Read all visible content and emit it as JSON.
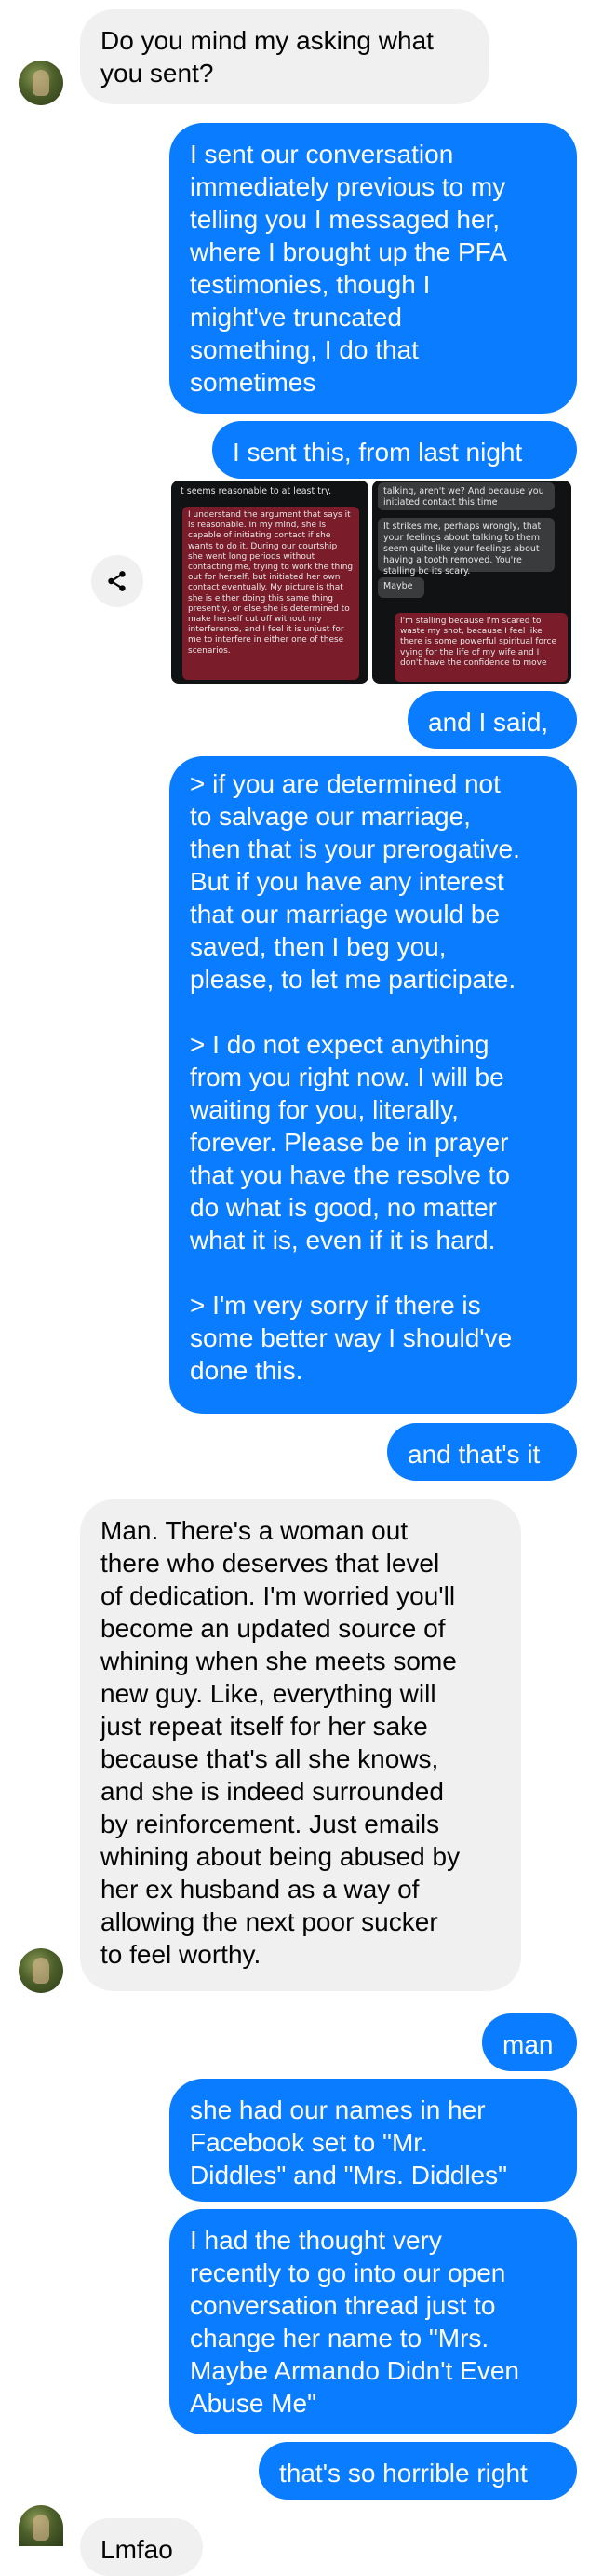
{
  "messages": [
    {
      "id": "m1",
      "dir": "in",
      "text": "Do you mind my asking what\nyou sent?"
    },
    {
      "id": "m2",
      "dir": "out",
      "text": "I sent our conversation\nimmediately previous to my\ntelling you I messaged her,\nwhere I brought up the PFA\ntestimonies, though I\nmight've truncated\nsomething, I do that\nsometimes"
    },
    {
      "id": "m3",
      "dir": "out",
      "text": "I sent this, from last night"
    },
    {
      "id": "m4",
      "dir": "out",
      "text": "and I said,"
    },
    {
      "id": "m5",
      "dir": "out",
      "text": "> if you are determined not\nto salvage our marriage,\nthen that is your prerogative.\nBut if you have any interest\nthat our marriage would be\nsaved, then I beg you,\nplease, to let me participate.\n\n> I do not expect anything\nfrom you right now. I will be\nwaiting for you, literally,\nforever. Please be in prayer\nthat you have the resolve to\ndo what is good, no matter\nwhat it is, even if it is hard.\n\n> I'm very sorry if there is\nsome better way I should've\ndone this."
    },
    {
      "id": "m6",
      "dir": "out",
      "text": "and that's it"
    },
    {
      "id": "m7",
      "dir": "in",
      "text": "Man. There's a woman out\nthere who deserves that level\nof dedication. I'm worried you'll\nbecome an updated source of\nwhining when she meets some\nnew guy. Like, everything will\njust repeat itself for her sake\nbecause that's all she knows,\nand she is indeed surrounded\nby reinforcement. Just emails\nwhining about being abused by\nher ex husband as a way of\nallowing the next poor sucker\nto feel worthy."
    },
    {
      "id": "m8",
      "dir": "out",
      "text": "man"
    },
    {
      "id": "m9",
      "dir": "out",
      "text": "she had our names in her\nFacebook set to \"Mr.\nDiddles\" and \"Mrs. Diddles\""
    },
    {
      "id": "m10",
      "dir": "out",
      "text": "I had the thought very\nrecently to go into our open\nconversation thread just to\nchange her name to \"Mrs.\nMaybe Armando Didn't Even\nAbuse Me\""
    },
    {
      "id": "m11",
      "dir": "out",
      "text": "that's so horrible right"
    },
    {
      "id": "m12",
      "dir": "in",
      "text": "Lmfao"
    }
  ],
  "attachments": {
    "left": {
      "top_text": "t seems reasonable to at least try.",
      "red_text": "I understand the argument that says it is reasonable. In my mind, she is capable of initiating contact if she wants to do it. During our courtship she went long periods without contacting me, trying to work the thing out for herself, but initiated her own contact eventually. My picture is that she is either doing this same thing presently, or else she is determined to make herself cut off without my interference, and I feel it is unjust for me to interfere in either one of these scenarios."
    },
    "right": {
      "top_text": "talking, aren't we? And because you initiated contact this time",
      "gray_text": "It strikes me, perhaps wrongly, that your feelings about talking to them seem quite like your feelings about having a tooth removed. You're stalling bc its scary.",
      "maybe_text": "Maybe",
      "red_text": "I'm stalling because I'm scared to waste my shot, because I feel like there is some powerful spiritual force vying for the life of my wife and I don't have the confidence to move"
    }
  },
  "icons": {
    "share": "share-icon",
    "avatar": "contact-avatar"
  },
  "colors": {
    "outgoing_bubble": "#0a7cff",
    "incoming_bubble": "#f0f0f0",
    "attachment_red": "#7b1c2a",
    "attachment_gray": "#3a3b3d"
  }
}
